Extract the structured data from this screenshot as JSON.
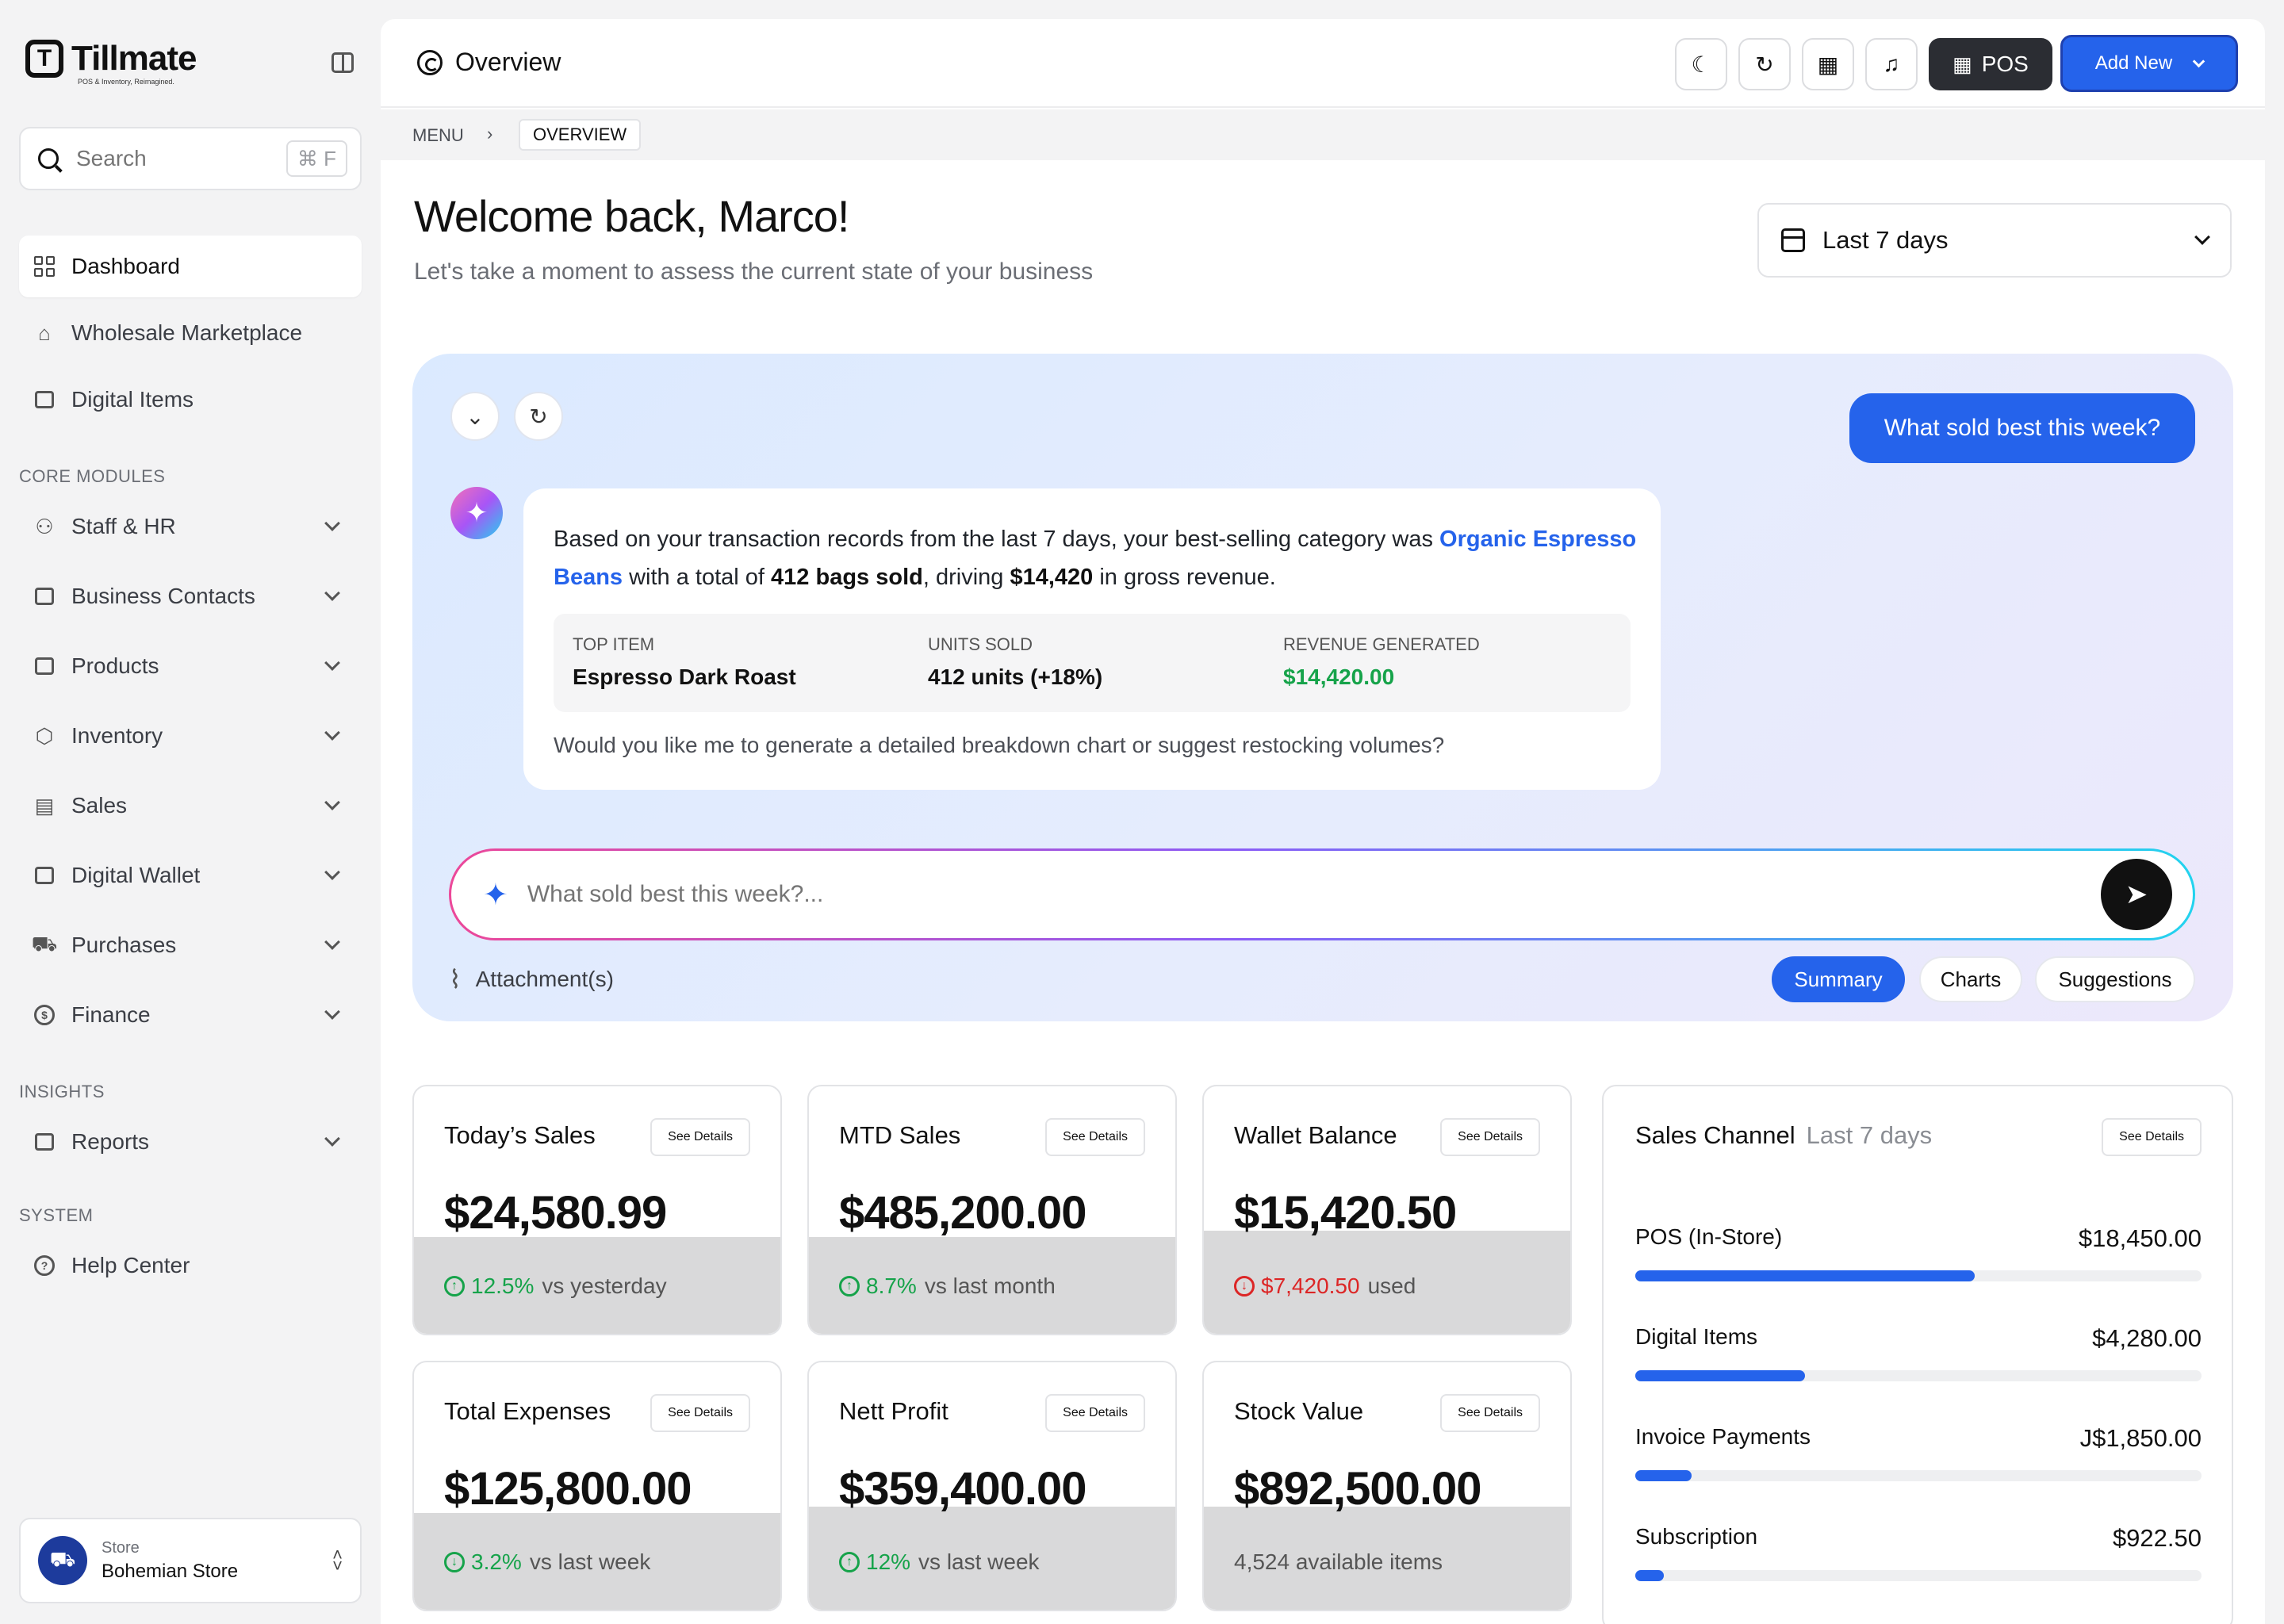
{
  "brand": {
    "name": "Tillmate",
    "tagline": "POS & Inventory, Reimagined.",
    "accent": "#2563eb"
  },
  "search": {
    "placeholder": "Search",
    "shortcut": "⌘ F"
  },
  "sidebar": {
    "top_items": [
      {
        "label": "Dashboard",
        "icon": "dashboard-icon",
        "active": true
      },
      {
        "label": "Wholesale Marketplace",
        "icon": "store-icon"
      },
      {
        "label": "Digital Items",
        "icon": "digital-items-icon"
      }
    ],
    "core_label": "CORE MODULES",
    "core_items": [
      {
        "label": "Staff & HR",
        "icon": "users-icon"
      },
      {
        "label": "Business Contacts",
        "icon": "briefcase-icon"
      },
      {
        "label": "Products",
        "icon": "box-icon"
      },
      {
        "label": "Inventory",
        "icon": "package-icon"
      },
      {
        "label": "Sales",
        "icon": "receipt-icon"
      },
      {
        "label": "Digital Wallet",
        "icon": "wallet-icon"
      },
      {
        "label": "Purchases",
        "icon": "cart-icon"
      },
      {
        "label": "Finance",
        "icon": "dollar-icon"
      }
    ],
    "insights_label": "INSIGHTS",
    "insights_items": [
      {
        "label": "Reports",
        "icon": "report-icon"
      }
    ],
    "system_label": "SYSTEM",
    "system_items": [
      {
        "label": "Help Center",
        "icon": "help-icon"
      }
    ],
    "store": {
      "label": "Store",
      "name": "Bohemian Store"
    }
  },
  "topbar": {
    "title": "Overview",
    "pos_label": "POS",
    "add_label": "Add New"
  },
  "breadcrumb": {
    "root": "MENU",
    "separator": "›",
    "current": "OVERVIEW"
  },
  "header": {
    "welcome": "Welcome back, Marco!",
    "subtitle": "Let's take a moment to assess the current state of your business",
    "date_range": "Last 7 days"
  },
  "assistant": {
    "user_message": "What sold best this week?",
    "reply": {
      "p1": "Based on your transaction records from the last 7 days, your best-selling category was ",
      "highlight": "Organic Espresso Beans",
      "p2": " with a total of ",
      "b1": "412 bags sold",
      "p3": ", driving ",
      "b2": "$14,420",
      "p4": " in gross revenue."
    },
    "stats": [
      {
        "label": "TOP ITEM",
        "value": "Espresso Dark Roast"
      },
      {
        "label": "UNITS SOLD",
        "value": "412 units (+18%)"
      },
      {
        "label": "REVENUE GENERATED",
        "value": "$14,420.00"
      }
    ],
    "follow_up": "Would you like me to generate a detailed breakdown chart or suggest restocking volumes?",
    "input_placeholder": "What sold best this week?...",
    "attachment_label": "Attachment(s)",
    "chips": [
      "Summary",
      "Charts",
      "Suggestions"
    ]
  },
  "kpis": [
    {
      "title": "Today’s Sales",
      "value": "$24,580.99",
      "delta": "12.5%",
      "suffix": "vs yesterday",
      "trend": "up"
    },
    {
      "title": "MTD Sales",
      "value": "$485,200.00",
      "delta": "8.7%",
      "suffix": "vs last month",
      "trend": "up"
    },
    {
      "title": "Wallet Balance",
      "value": "$15,420.50",
      "delta": "$7,420.50",
      "suffix": "used",
      "trend": "down"
    },
    {
      "title": "Total Expenses",
      "value": "$125,800.00",
      "delta": "3.2%",
      "suffix": "vs last week",
      "trend": "down-green"
    },
    {
      "title": "Nett Profit",
      "value": "$359,400.00",
      "delta": "12%",
      "suffix": "vs last week",
      "trend": "up"
    },
    {
      "title": "Stock Value",
      "value": "$892,500.00",
      "delta": "",
      "suffix": "4,524 available items",
      "trend": "none"
    }
  ],
  "details_label": "See Details",
  "sales_channel": {
    "title": "Sales Channel",
    "range": "Last 7 days",
    "rows": [
      {
        "label": "POS (In-Store)",
        "value": "$18,450.00",
        "share": 0.6
      },
      {
        "label": "Digital Items",
        "value": "$4,280.00",
        "share": 0.3
      },
      {
        "label": "Invoice Payments",
        "value": "J$1,850.00",
        "share": 0.1
      },
      {
        "label": "Subscription",
        "value": "$922.50",
        "share": 0.05
      }
    ]
  }
}
